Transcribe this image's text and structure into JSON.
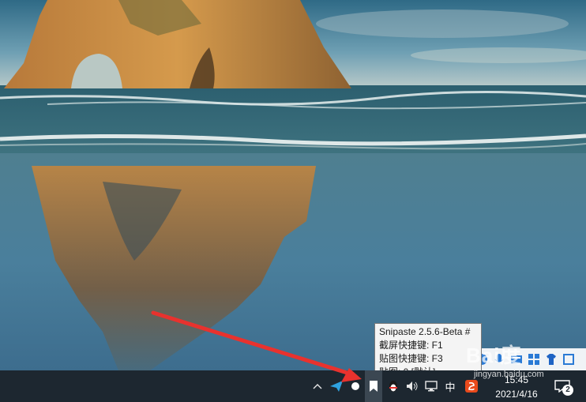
{
  "tooltip": {
    "title": "Snipaste 2.5.6-Beta #",
    "line1": "截屏快捷键: F1",
    "line2": "贴图快捷键: F3",
    "line3": "贴图: 0 [默认]"
  },
  "tray": {
    "ime_label": "中",
    "time": "15:45",
    "date": "2021/4/16",
    "notification_count": "2"
  },
  "watermark": {
    "text": "Bai度",
    "url": "jingyan.baidu.com"
  },
  "colors": {
    "taskbar": "#1d2730",
    "arrow": "#e8322e",
    "tooltip_bg": "#f4f4f4"
  },
  "icons": [
    "chevron-up-icon",
    "paper-plane-icon",
    "snipaste-icon",
    "qq-penguin-icon",
    "volume-icon",
    "network-icon",
    "ime-icon",
    "sogou-icon",
    "notification-icon"
  ]
}
